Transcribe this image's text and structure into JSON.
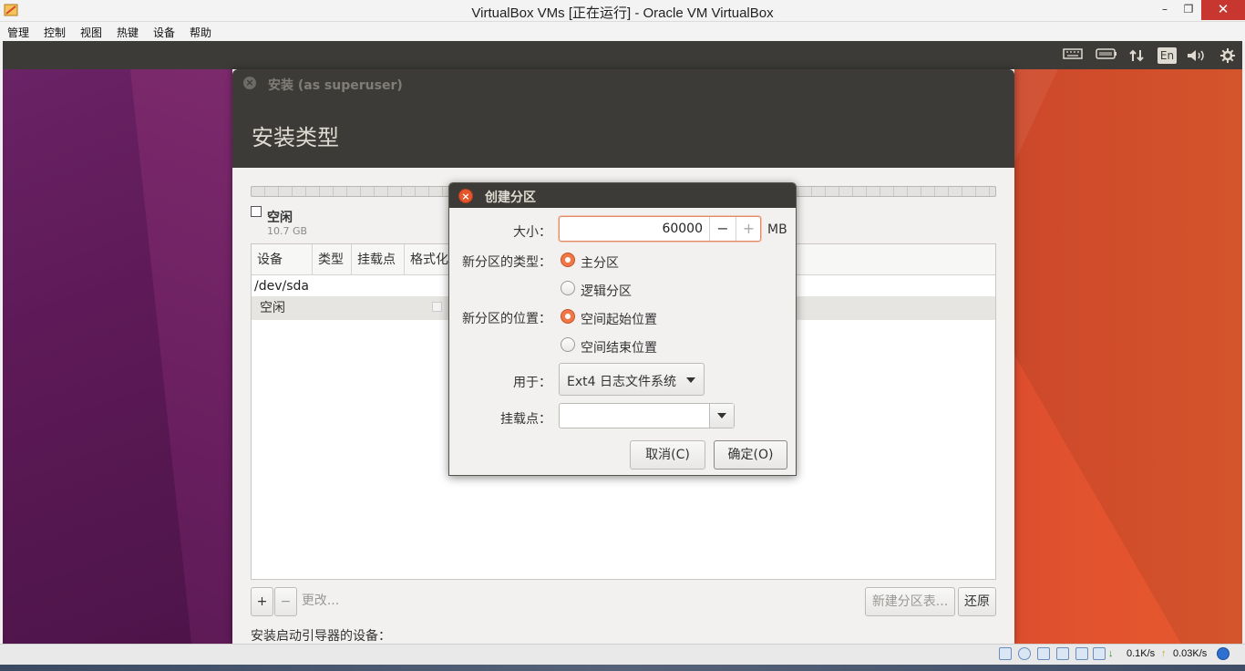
{
  "host": {
    "title": "VirtualBox VMs [正在运行] - Oracle VM VirtualBox",
    "menu": [
      "管理",
      "控制",
      "视图",
      "热键",
      "设备",
      "帮助"
    ],
    "win_controls": {
      "minimize": "–",
      "restore": "❐",
      "close": "✕"
    }
  },
  "guest_panel": {
    "indicators": [
      {
        "name": "keyboard-icon",
        "glyph": "⌨"
      },
      {
        "name": "battery-icon",
        "glyph": "▭"
      },
      {
        "name": "network-icon",
        "glyph": "⇅"
      },
      {
        "name": "language-indicator",
        "glyph": "En"
      },
      {
        "name": "volume-icon",
        "glyph": "🔊"
      },
      {
        "name": "gear-icon",
        "glyph": "⚙"
      }
    ]
  },
  "installer": {
    "window_title": "安装 (as superuser)",
    "page_title": "安装类型",
    "free_label": "空闲",
    "free_size": "10.7 GB",
    "table": {
      "headers": [
        "设备",
        "类型",
        "挂载点",
        "格式化"
      ],
      "device": "/dev/sda",
      "free_row": "空闲"
    },
    "buttons": {
      "add": "+",
      "remove": "−",
      "change": "更改...",
      "new_table": "新建分区表...",
      "revert": "还原"
    },
    "boot_label": "安装启动引导器的设备："
  },
  "dialog": {
    "title": "创建分区",
    "size_label": "大小：",
    "size_value": "60000",
    "size_unit": "MB",
    "type_label": "新分区的类型：",
    "type_options": [
      "主分区",
      "逻辑分区"
    ],
    "type_selected": 0,
    "location_label": "新分区的位置：",
    "location_options": [
      "空间起始位置",
      "空间结束位置"
    ],
    "location_selected": 0,
    "use_label": "用于：",
    "use_value": "Ext4 日志文件系统",
    "mount_label": "挂载点：",
    "mount_value": "",
    "cancel": "取消(C)",
    "ok": "确定(O)"
  },
  "status": {
    "download": "0.1K/s",
    "upload": "0.03K/s",
    "down_arrow": "↓",
    "up_arrow": "↑"
  },
  "colors": {
    "accent": "#f07746",
    "panel": "#3c3b37",
    "dialog_close": "#e6562c"
  }
}
